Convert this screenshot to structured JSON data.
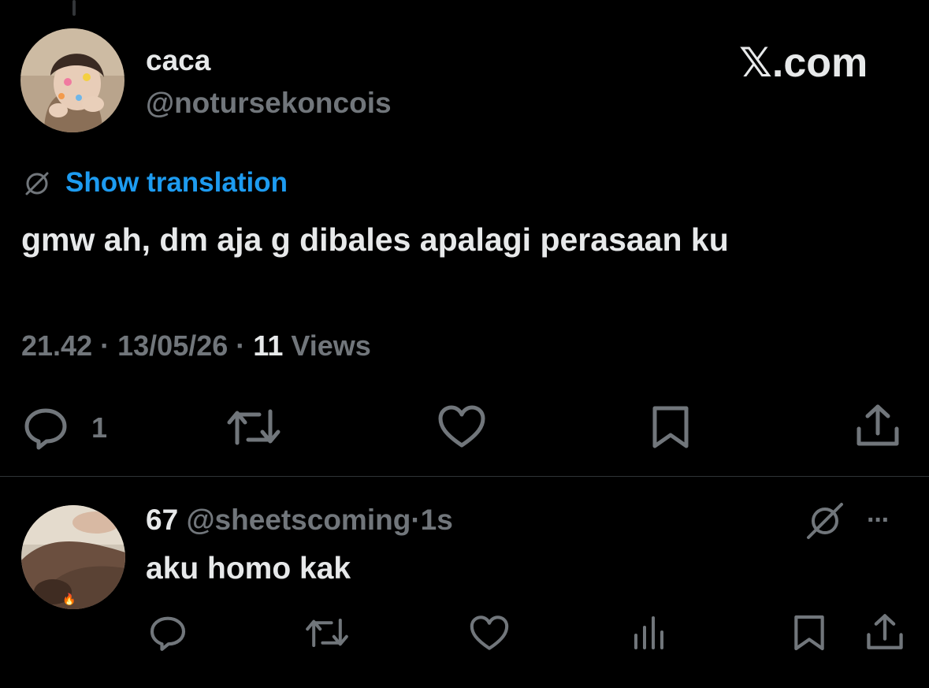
{
  "tweet": {
    "author_name": "caca",
    "author_handle": "@notursekoncois",
    "brand": "𝕏.com",
    "show_translation": "Show translation",
    "text": "gmw ah, dm aja g dibales apalagi perasaan ku",
    "time": "21.42",
    "sep1": "·",
    "date": "13/05/26",
    "sep2": "·",
    "views_count": "11",
    "views_label": "Views",
    "reply_count": "1",
    "icons": [
      "reply-icon",
      "retweet-icon",
      "like-icon",
      "bookmark-icon",
      "share-icon",
      "translate-icon"
    ]
  },
  "reply": {
    "author_name": "67",
    "author_handle": "@sheetscoming",
    "sep": "·",
    "time": "1s",
    "text": "aku homo kak",
    "more": "···",
    "icons": [
      "reply-icon",
      "retweet-icon",
      "like-icon",
      "views-icon",
      "bookmark-icon",
      "share-icon",
      "grok-icon",
      "more-icon"
    ]
  },
  "colors": {
    "background": "#000000",
    "text": "#e7e9ea",
    "secondary": "#71767b",
    "link": "#1d9bf0",
    "divider": "#2f3336"
  }
}
